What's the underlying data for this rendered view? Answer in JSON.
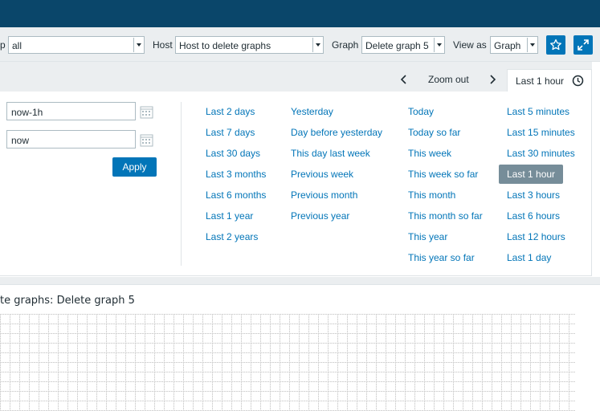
{
  "filter": {
    "group_label_tail": "p",
    "group_value": "all",
    "host_label": "Host",
    "host_value": "Host to delete graphs",
    "graph_label": "Graph",
    "graph_value": "Delete graph 5",
    "viewas_label": "View as",
    "viewas_value": "Graph",
    "favorite_icon": "star-icon",
    "fullscreen_icon": "fullscreen-icon"
  },
  "timebar": {
    "zoom_out_label": "Zoom out",
    "active_tab_label": "Last 1 hour",
    "from_value": "now-1h",
    "to_value": "now",
    "apply_label": "Apply",
    "columns": [
      [
        "Last 2 days",
        "Last 7 days",
        "Last 30 days",
        "Last 3 months",
        "Last 6 months",
        "Last 1 year",
        "Last 2 years"
      ],
      [
        "Yesterday",
        "Day before yesterday",
        "This day last week",
        "Previous week",
        "Previous month",
        "Previous year"
      ],
      [
        "Today",
        "Today so far",
        "This week",
        "This week so far",
        "This month",
        "This month so far",
        "This year",
        "This year so far"
      ],
      [
        "Last 5 minutes",
        "Last 15 minutes",
        "Last 30 minutes",
        "Last 1 hour",
        "Last 3 hours",
        "Last 6 hours",
        "Last 12 hours",
        "Last 1 day"
      ]
    ],
    "selected": "Last 1 hour"
  },
  "graph": {
    "title": "te graphs: Delete graph 5"
  },
  "colors": {
    "header": "#0a466a",
    "accent": "#0275b8",
    "selected_bg": "#768d99",
    "panel_bg": "#ebeef0"
  }
}
